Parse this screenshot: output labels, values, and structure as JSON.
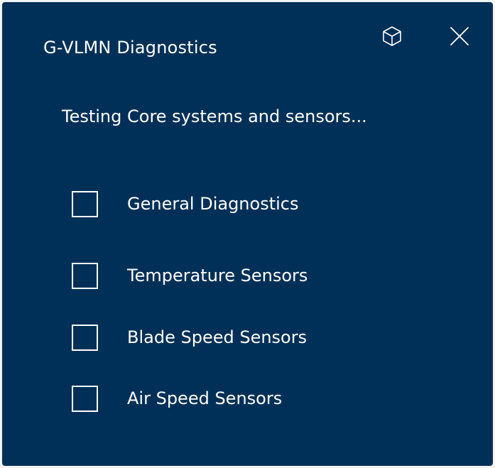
{
  "dialog": {
    "title": "G-VLMN Diagnostics",
    "subtitle": "Testing Core systems and sensors...",
    "header_icons": [
      "cube-icon",
      "close-icon"
    ]
  },
  "checklist": [
    {
      "label": "General Diagnostics",
      "checked": false
    },
    {
      "label": "Temperature Sensors",
      "checked": false
    },
    {
      "label": "Blade Speed Sensors",
      "checked": false
    },
    {
      "label": "Air Speed Sensors",
      "checked": false
    }
  ],
  "colors": {
    "panel_background": "#003057",
    "text": "#ffffff"
  }
}
